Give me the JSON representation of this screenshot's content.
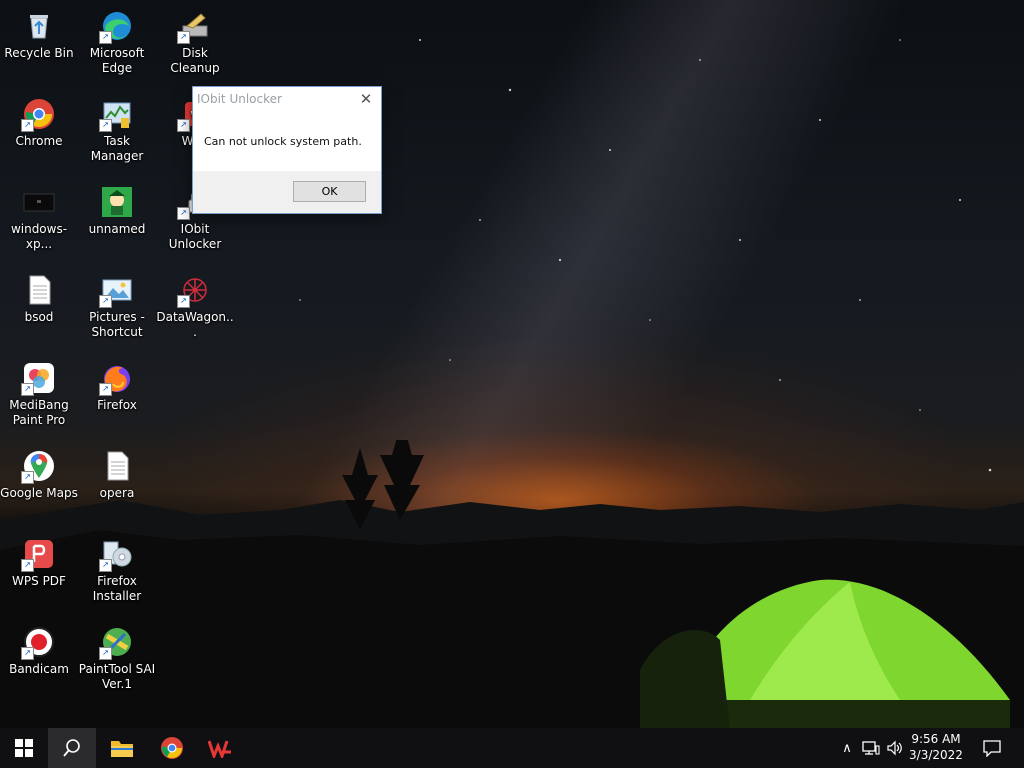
{
  "desktop": {
    "icons": [
      {
        "label": "Recycle Bin"
      },
      {
        "label": "Microsoft Edge"
      },
      {
        "label": "Disk Cleanup"
      },
      {
        "label": "Chrome"
      },
      {
        "label": "Task Manager"
      },
      {
        "label": "WPS"
      },
      {
        "label": "windows-xp..."
      },
      {
        "label": "unnamed"
      },
      {
        "label": "IObit Unlocker"
      },
      {
        "label": "bsod"
      },
      {
        "label": "Pictures - Shortcut"
      },
      {
        "label": "DataWagon..."
      },
      {
        "label": "MediBang Paint Pro"
      },
      {
        "label": "Firefox"
      },
      {
        "label": "Google Maps"
      },
      {
        "label": "opera"
      },
      {
        "label": "WPS PDF"
      },
      {
        "label": "Firefox Installer"
      },
      {
        "label": "Bandicam"
      },
      {
        "label": "PaintTool SAI Ver.1"
      }
    ]
  },
  "dialog": {
    "title": "IObit Unlocker",
    "close_glyph": "✕",
    "message": "Can not unlock system path.",
    "ok_label": "OK"
  },
  "taskbar": {
    "time": "9:56 AM",
    "date": "3/3/2022",
    "tray_chevron": "∧"
  },
  "colors": {
    "taskbar_bg": "#101012",
    "dialog_border": "#7a9cc8",
    "tent_green": "#8be03a"
  }
}
